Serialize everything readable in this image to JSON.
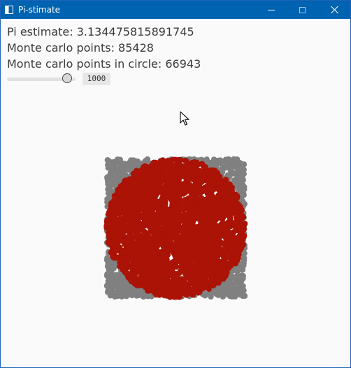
{
  "window": {
    "title": "Pi-stimate",
    "icon": "app-window-icon",
    "buttons": [
      "minimize-icon",
      "maximize-icon",
      "close-icon"
    ]
  },
  "stats": {
    "pi_estimate": "Pi estimate: 3.134475815891745",
    "points": "Monte carlo points: 85428",
    "points_in_circle": "Monte carlo points in circle: 66943"
  },
  "slider": {
    "value": "1000",
    "fraction": 0.93
  },
  "plot": {
    "colors": {
      "outside": "#808080",
      "inside": "#aa1305",
      "highlight": "#f2e35a"
    }
  },
  "colors": {
    "titlebar": "#0063b1",
    "background": "#fafafa",
    "text": "#3a3a3a"
  }
}
